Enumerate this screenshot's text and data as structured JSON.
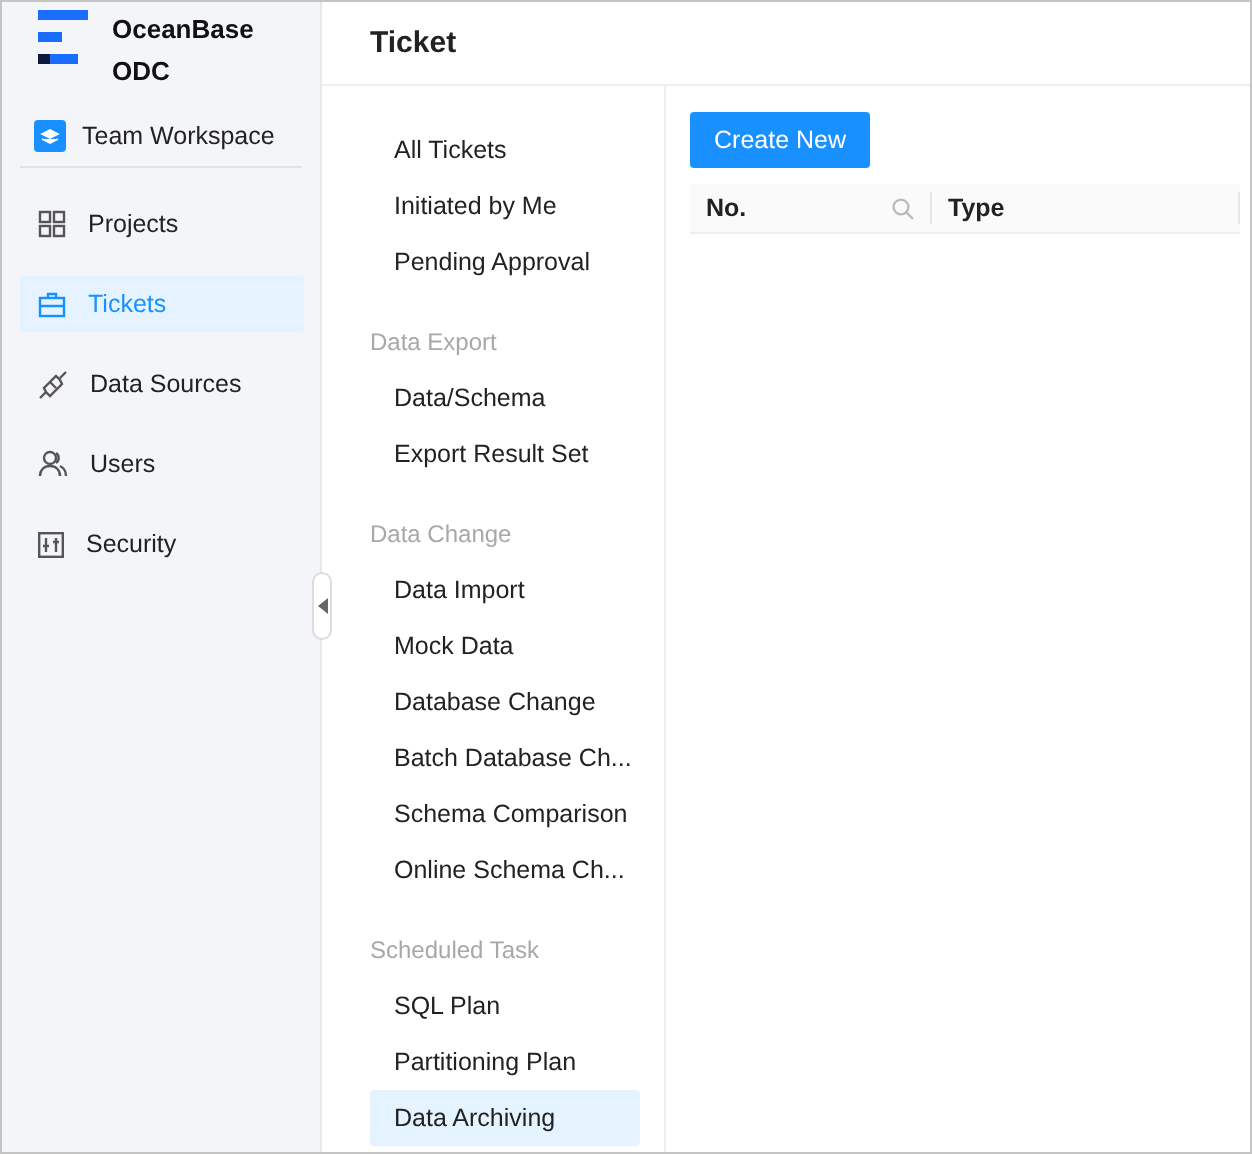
{
  "sidebar": {
    "logo": {
      "line_1": "OceanBase",
      "line_2": "ODC"
    },
    "workspace": {
      "label": "Team Workspace"
    },
    "nav": [
      {
        "label": "Projects",
        "selected": false
      },
      {
        "label": "Tickets",
        "selected": true
      },
      {
        "label": "Data Sources",
        "selected": false
      },
      {
        "label": "Users",
        "selected": false
      },
      {
        "label": "Security",
        "selected": false
      }
    ]
  },
  "header": {
    "title": "Ticket"
  },
  "menu": [
    {
      "items": [
        {
          "label": "All Tickets",
          "selected": false
        },
        {
          "label": "Initiated by Me",
          "selected": false
        },
        {
          "label": "Pending Approval",
          "selected": false
        }
      ]
    },
    {
      "title": "Data Export",
      "items": [
        {
          "label": "Data/Schema",
          "selected": false
        },
        {
          "label": "Export Result Set",
          "selected": false
        }
      ]
    },
    {
      "title": "Data Change",
      "items": [
        {
          "label": "Data Import",
          "selected": false
        },
        {
          "label": "Mock Data",
          "selected": false
        },
        {
          "label": "Database Change",
          "selected": false
        },
        {
          "label": "Batch Database Ch...",
          "selected": false
        },
        {
          "label": "Schema Comparison",
          "selected": false
        },
        {
          "label": "Online Schema Ch...",
          "selected": false
        }
      ]
    },
    {
      "title": "Scheduled Task",
      "items": [
        {
          "label": "SQL Plan",
          "selected": false
        },
        {
          "label": "Partitioning Plan",
          "selected": false
        },
        {
          "label": "Data Archiving",
          "selected": true
        }
      ]
    }
  ],
  "content": {
    "create_button": "Create New",
    "columns": [
      {
        "label": "No.",
        "kind": "search"
      },
      {
        "label": "Type",
        "kind": "plain"
      }
    ]
  }
}
